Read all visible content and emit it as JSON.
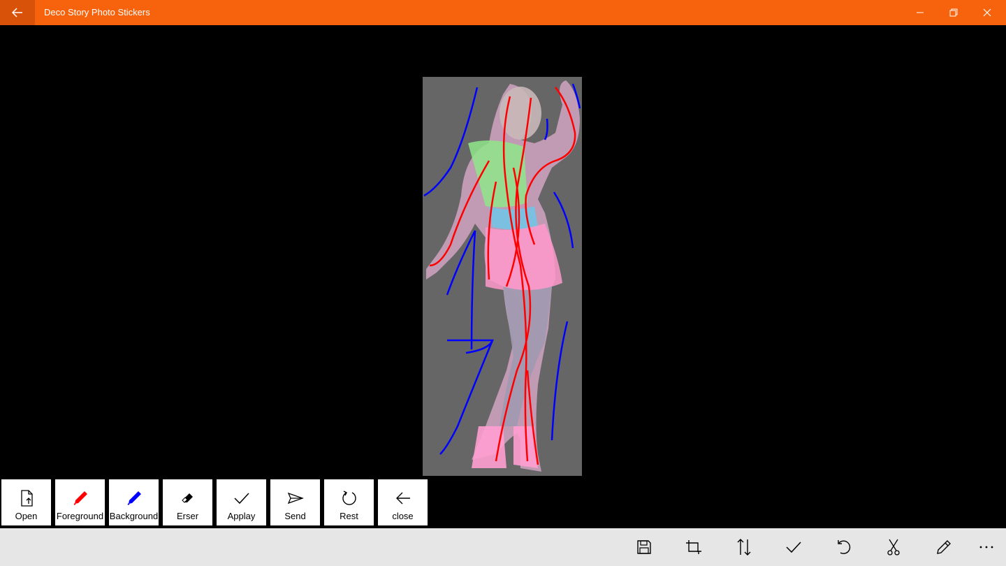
{
  "window": {
    "title": "Deco Story Photo Stickers",
    "accent": "#f7630c",
    "icons": [
      "back-arrow-icon",
      "minimize-icon",
      "restore-icon",
      "close-icon"
    ]
  },
  "canvas": {
    "background": "#000000",
    "photo_background": "#666666",
    "foreground_stroke_color": "#ff0000",
    "background_stroke_color": "#0000ff"
  },
  "toolbar": {
    "tools": [
      {
        "label": "Open",
        "icon": "open-file-icon"
      },
      {
        "label": "Foreground",
        "icon": "red-marker-icon",
        "color": "#ff0000"
      },
      {
        "label": "Background",
        "icon": "blue-marker-icon",
        "color": "#0000ff"
      },
      {
        "label": "Erser",
        "icon": "eraser-icon"
      },
      {
        "label": "Applay",
        "icon": "checkmark-icon"
      },
      {
        "label": "Send",
        "icon": "send-icon"
      },
      {
        "label": "Rest",
        "icon": "reset-icon"
      },
      {
        "label": "close",
        "icon": "back-arrow-icon"
      }
    ]
  },
  "appbar": {
    "buttons": [
      "save-icon",
      "crop-icon",
      "sort-icon",
      "accept-icon",
      "redo-icon",
      "cut-icon",
      "edit-pencil-icon",
      "more-icon"
    ]
  }
}
